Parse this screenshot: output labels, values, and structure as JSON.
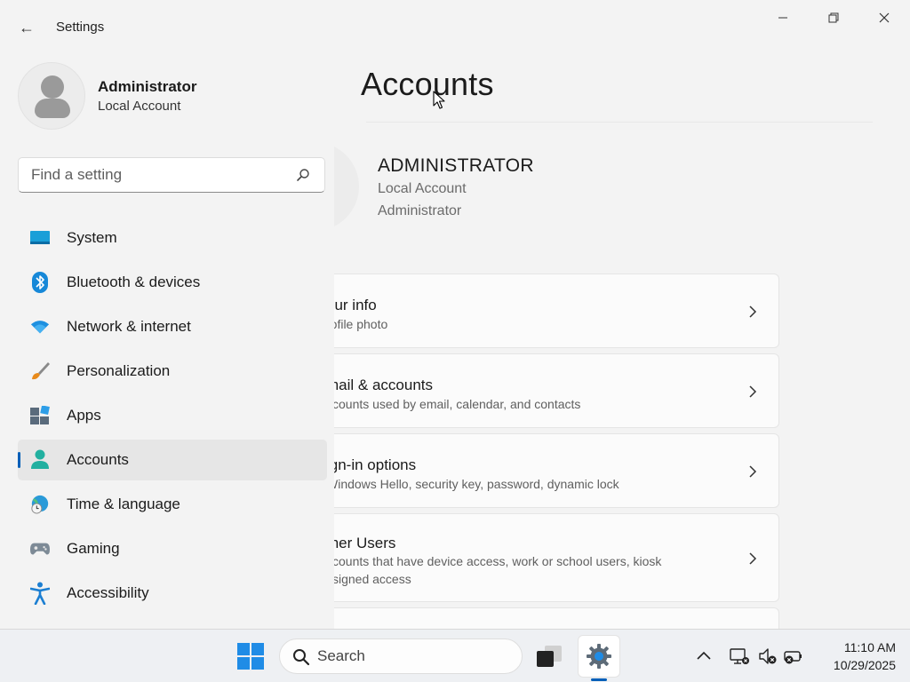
{
  "window": {
    "title": "Settings",
    "back_glyph": "←",
    "minimize_glyph": "—",
    "maximize_glyph": "❐",
    "close_glyph": "✕"
  },
  "user": {
    "name": "Administrator",
    "type": "Local Account"
  },
  "search": {
    "placeholder": "Find a setting"
  },
  "nav": {
    "items": [
      {
        "label": "System",
        "icon": "system-icon"
      },
      {
        "label": "Bluetooth & devices",
        "icon": "bluetooth-icon"
      },
      {
        "label": "Network & internet",
        "icon": "wifi-icon"
      },
      {
        "label": "Personalization",
        "icon": "brush-icon"
      },
      {
        "label": "Apps",
        "icon": "apps-icon"
      },
      {
        "label": "Accounts",
        "icon": "accounts-icon",
        "active": true
      },
      {
        "label": "Time & language",
        "icon": "globe-clock-icon"
      },
      {
        "label": "Gaming",
        "icon": "gamepad-icon"
      },
      {
        "label": "Accessibility",
        "icon": "accessibility-icon"
      }
    ]
  },
  "main": {
    "title": "Accounts",
    "account": {
      "name": "ADMINISTRATOR",
      "type": "Local Account",
      "role": "Administrator"
    },
    "cards": [
      {
        "title": "our info",
        "desc": "rofile photo"
      },
      {
        "title": "mail & accounts",
        "desc": "ccounts used by email, calendar, and contacts"
      },
      {
        "title": "ign-in options",
        "desc": "Windows Hello, security key, password, dynamic lock"
      },
      {
        "title": "ther Users",
        "desc": "ccounts that have device access, work or school users, kiosk",
        "desc2": "ssigned access"
      }
    ]
  },
  "taskbar": {
    "search_label": "Search",
    "time": "11:10 AM",
    "date": "10/29/2025"
  },
  "colors": {
    "accent": "#005fb8",
    "background": "#f3f3f3",
    "card": "#fbfbfb",
    "taskbar": "#eef0f3"
  }
}
